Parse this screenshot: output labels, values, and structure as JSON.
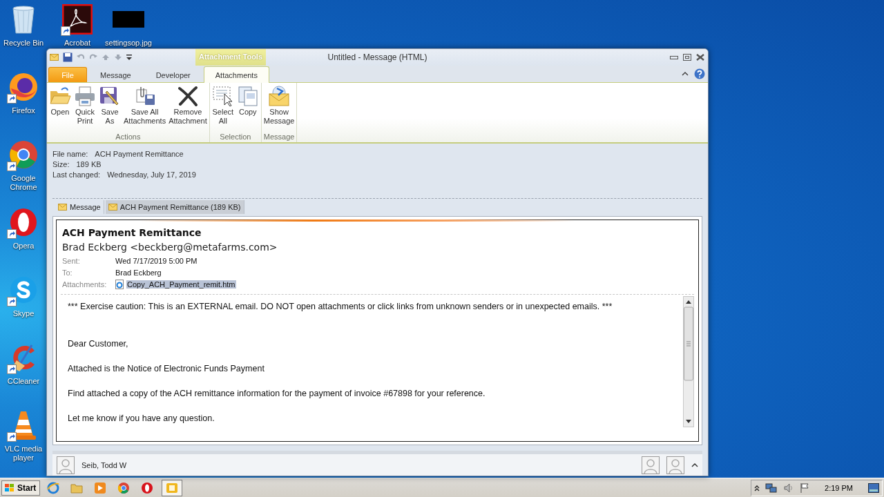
{
  "desktop_icons": [
    {
      "label": "Recycle Bin",
      "kind": "recycle",
      "shortcut": false
    },
    {
      "label": "Firefox",
      "kind": "firefox",
      "shortcut": true
    },
    {
      "label": "Google Chrome",
      "kind": "chrome",
      "shortcut": true
    },
    {
      "label": "Opera",
      "kind": "opera",
      "shortcut": true
    },
    {
      "label": "Skype",
      "kind": "skype",
      "shortcut": true
    },
    {
      "label": "CCleaner",
      "kind": "ccleaner",
      "shortcut": true
    },
    {
      "label": "VLC media player",
      "kind": "vlc",
      "shortcut": true
    }
  ],
  "top_icons": [
    {
      "label": "Acrobat",
      "kind": "acrobat",
      "shortcut": true
    },
    {
      "label": "settingsop.jpg",
      "kind": "blackimage",
      "shortcut": false
    }
  ],
  "window": {
    "title": "Untitled - Message (HTML)",
    "contextual_tab": "Attachment Tools",
    "tabs": [
      {
        "label": "File",
        "kind": "file",
        "selected": false
      },
      {
        "label": "Message",
        "kind": "normal",
        "selected": false
      },
      {
        "label": "Developer",
        "kind": "normal",
        "selected": false
      },
      {
        "label": "Attachments",
        "kind": "normal",
        "selected": true
      }
    ],
    "ribbon_groups": [
      {
        "label": "Actions",
        "buttons": [
          {
            "lines": [
              "Open"
            ],
            "kind": "open"
          },
          {
            "lines": [
              "Quick",
              "Print"
            ],
            "kind": "print"
          },
          {
            "lines": [
              "Save",
              "As"
            ],
            "kind": "saveas"
          },
          {
            "lines": [
              "Save All",
              "Attachments"
            ],
            "kind": "saveall"
          },
          {
            "lines": [
              "Remove",
              "Attachment"
            ],
            "kind": "remove"
          }
        ]
      },
      {
        "label": "Selection",
        "buttons": [
          {
            "lines": [
              "Select",
              "All"
            ],
            "kind": "selectall"
          },
          {
            "lines": [
              "Copy"
            ],
            "kind": "copy"
          }
        ]
      },
      {
        "label": "Message",
        "buttons": [
          {
            "lines": [
              "Show",
              "Message"
            ],
            "kind": "showmessage"
          }
        ]
      }
    ],
    "file_info": [
      {
        "label": "File name:",
        "value": "ACH Payment Remittance"
      },
      {
        "label": "Size:",
        "value": "189 KB"
      },
      {
        "label": "Last changed:",
        "value": "Wednesday, July 17, 2019"
      }
    ],
    "attachment_tabs": [
      {
        "label": "Message",
        "selected": false
      },
      {
        "label": "ACH Payment Remittance (189 KB)",
        "selected": true
      }
    ],
    "message": {
      "subject": "ACH Payment Remittance",
      "sender": "Brad Eckberg <beckberg@metafarms.com>",
      "fields": [
        {
          "label": "Sent:",
          "value": "Wed 7/17/2019 5:00 PM",
          "kind": "text",
          "selected": false
        },
        {
          "label": "To:",
          "value": "Brad Eckberg",
          "kind": "text",
          "selected": false
        },
        {
          "label": "Attachments:",
          "value": "Copy_ACH_Payment_remit.htm",
          "kind": "attachment",
          "selected": true
        }
      ],
      "body": [
        "*** Exercise caution: This is an EXTERNAL email. DO NOT open attachments or click links from unknown senders or in unexpected emails. ***",
        "Dear Customer,",
        "Attached is the Notice of Electronic Funds Payment",
        "Find attached a copy of the ACH remittance information for the payment of invoice #67898 for your reference.",
        "Let me know if you have any question."
      ]
    },
    "people_pane": {
      "name": "Seib, Todd W"
    }
  },
  "taskbar": {
    "start": "Start",
    "apps": [
      {
        "kind": "ie",
        "selected": false
      },
      {
        "kind": "explorer",
        "selected": false
      },
      {
        "kind": "media",
        "selected": false
      },
      {
        "kind": "chrome",
        "selected": false
      },
      {
        "kind": "opera",
        "selected": false
      },
      {
        "kind": "outlook",
        "selected": true
      }
    ],
    "clock": "2:19 PM"
  }
}
